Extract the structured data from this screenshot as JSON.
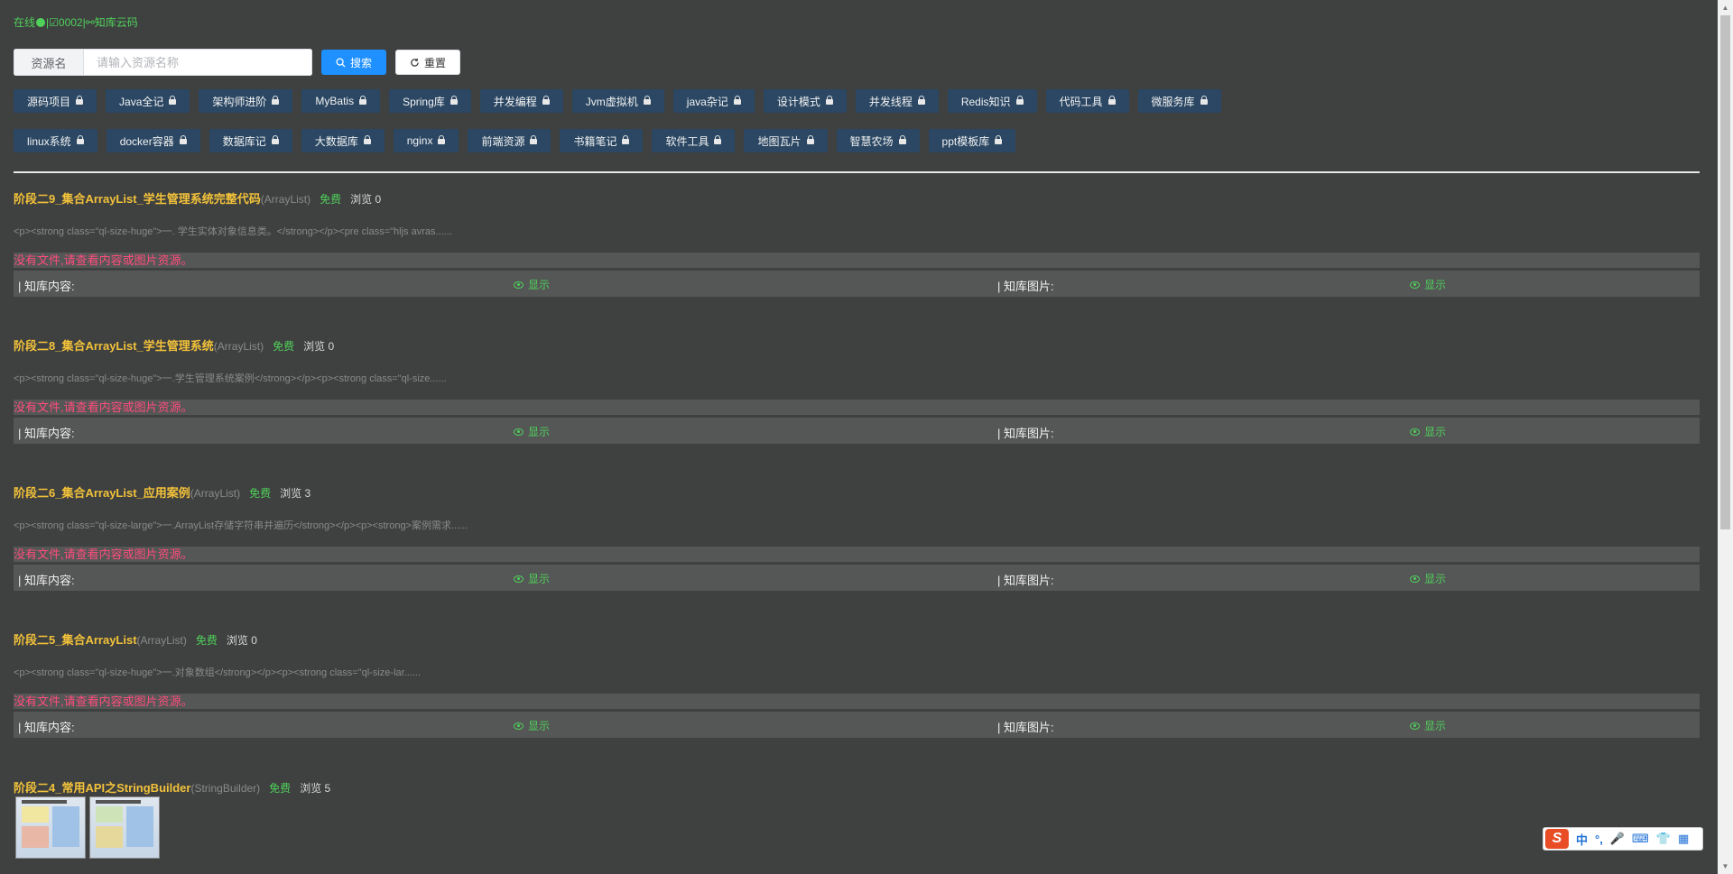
{
  "status": {
    "online": "在线",
    "code": "|☑0002|",
    "brand": "⚯知库云码"
  },
  "search": {
    "label": "资源名",
    "placeholder": "请输入资源名称",
    "search_button": "搜索",
    "reset_button": "重置"
  },
  "tags_row1": [
    "源码项目",
    "Java全记",
    "架构师进阶",
    "MyBatis",
    "Spring库",
    "并发编程",
    "Jvm虚拟机",
    "java杂记",
    "设计模式",
    "并发线程",
    "Redis知识",
    "代码工具",
    "微服务库"
  ],
  "tags_row2": [
    "linux系统",
    "docker容器",
    "数据库记",
    "大数据库",
    "nginx",
    "前端资源",
    "书籍笔记",
    "软件工具",
    "地图瓦片",
    "智慧农场",
    "ppt模板库"
  ],
  "entries": [
    {
      "title": "阶段二9_集合ArrayList_学生管理系统完整代码",
      "tag": "(ArrayList)",
      "free": "免费",
      "views": "浏览 0",
      "summary": "<p><strong class=\"ql-size-huge\">一. 学生实体对象信息类。</strong></p><pre class=\"hljs avras......",
      "no_file": "没有文件,请查看内容或图片资源。",
      "content_label": "| 知库内容:",
      "image_label": "| 知库图片:",
      "show": "显示"
    },
    {
      "title": "阶段二8_集合ArrayList_学生管理系统",
      "tag": "(ArrayList)",
      "free": "免费",
      "views": "浏览 0",
      "summary": "<p><strong class=\"ql-size-huge\">一.学生管理系统案例</strong></p><p><strong class=\"ql-size......",
      "no_file": "没有文件,请查看内容或图片资源。",
      "content_label": "| 知库内容:",
      "image_label": "| 知库图片:",
      "show": "显示"
    },
    {
      "title": "阶段二6_集合ArrayList_应用案例",
      "tag": "(ArrayList)",
      "free": "免费",
      "views": "浏览 3",
      "summary": "<p><strong class=\"ql-size-large\">一.ArrayList存储字符串并遍历</strong></p><p><strong>案例需求......",
      "no_file": "没有文件,请查看内容或图片资源。",
      "content_label": "| 知库内容:",
      "image_label": "| 知库图片:",
      "show": "显示"
    },
    {
      "title": "阶段二5_集合ArrayList",
      "tag": "(ArrayList)",
      "free": "免费",
      "views": "浏览 0",
      "summary": "<p><strong class=\"ql-size-huge\">一.对象数组</strong></p><p><strong class=\"ql-size-lar......",
      "no_file": "没有文件,请查看内容或图片资源。",
      "content_label": "| 知库内容:",
      "image_label": "| 知库图片:",
      "show": "显示"
    }
  ],
  "last_entry": {
    "title": "阶段二4_常用API之StringBuilder",
    "tag": "(StringBuilder)",
    "free": "免费",
    "views": "浏览 5"
  },
  "ime": {
    "logo": "S",
    "lang": "中",
    "punct": "°,",
    "mic": "🎤",
    "keyboard": "⌨",
    "skin": "👕",
    "grid": "▦"
  }
}
